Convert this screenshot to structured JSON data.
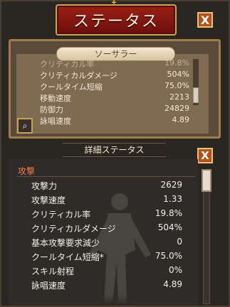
{
  "window": {
    "title": "ステータス",
    "close_label": "X"
  },
  "summary": {
    "class_name": "ソーサラー",
    "rows": [
      {
        "label": "クリティカル率",
        "value": "19.8%"
      },
      {
        "label": "クリティカルダメージ",
        "value": "504%"
      },
      {
        "label": "クールタイム短縮",
        "value": "75.0%"
      },
      {
        "label": "移動速度",
        "value": "2213"
      },
      {
        "label": "防御力",
        "value": "24829"
      },
      {
        "label": "詠唱速度",
        "value": "4.89"
      }
    ]
  },
  "detail": {
    "title": "詳細ステータス",
    "section": "攻撃",
    "rows": [
      {
        "label": "攻撃力",
        "value": "2629"
      },
      {
        "label": "攻撃速度",
        "value": "1.33"
      },
      {
        "label": "クリティカル率",
        "value": "19.8%"
      },
      {
        "label": "クリティカルダメージ",
        "value": "504%"
      },
      {
        "label": "基本攻撃要求減少",
        "value": "0"
      },
      {
        "label": "クールタイム短縮*",
        "value": "75.0%"
      },
      {
        "label": "スキル射程",
        "value": "0%"
      },
      {
        "label": "詠唱速度",
        "value": "4.89"
      }
    ]
  },
  "colors": {
    "accent": "#b3501d",
    "banner": "#8a1b12",
    "section": "#f07a4a"
  }
}
